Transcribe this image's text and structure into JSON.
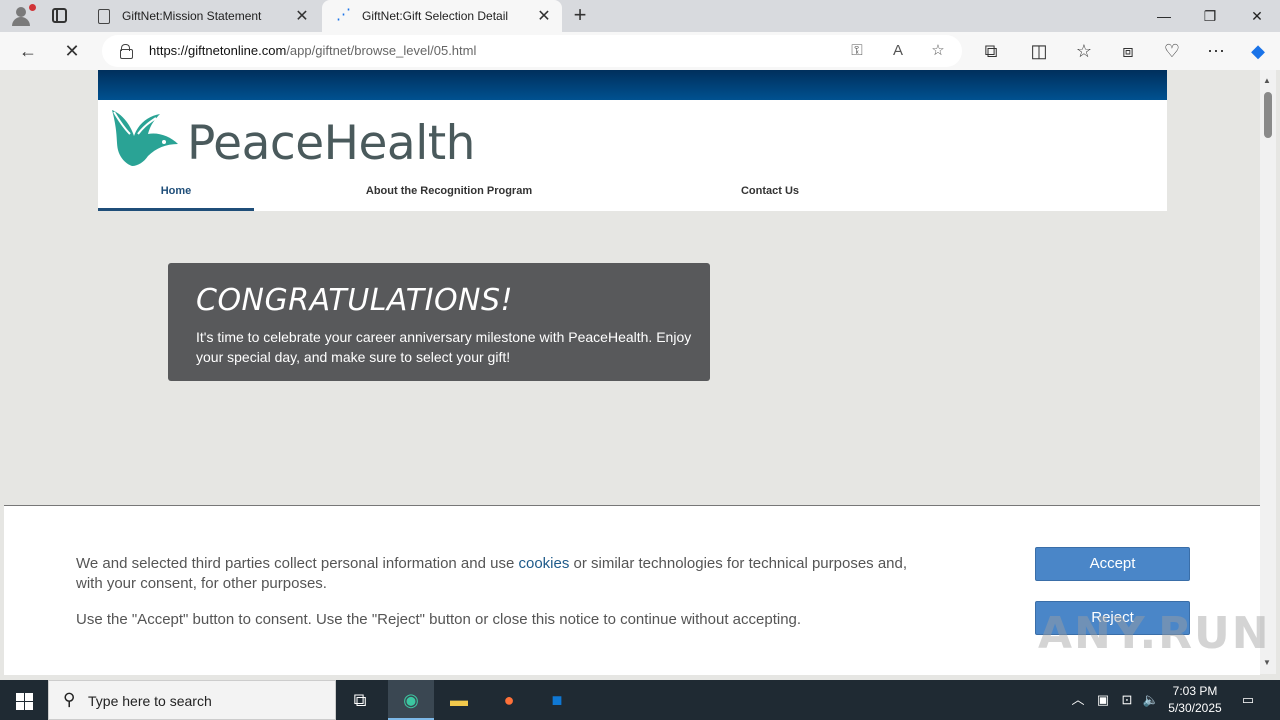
{
  "browser": {
    "tabs": [
      {
        "title": "GiftNet:Mission Statement",
        "active": false
      },
      {
        "title": "GiftNet:Gift Selection Detail",
        "active": true
      }
    ],
    "url_host": "https://giftnetonline.com",
    "url_path": "/app/giftnet/browse_level/05.html"
  },
  "site": {
    "brand": "PeaceHealth",
    "brand_color": "#2aa395",
    "nav": [
      {
        "label": "Home",
        "active": true
      },
      {
        "label": "About the Recognition Program",
        "active": false
      },
      {
        "label": "Contact Us",
        "active": false
      }
    ],
    "congrats": {
      "heading": "CONGRATULATIONS!",
      "body": "It's time to celebrate your career anniversary milestone with PeaceHealth. Enjoy your special day, and make sure to select your gift!"
    }
  },
  "cookie_banner": {
    "text1_before": "We and selected third parties collect personal information and use ",
    "text1_link": "cookies",
    "text1_after": " or similar technologies for technical purposes and, with your consent, for other purposes.",
    "text2": "Use the \"Accept\" button to consent. Use the \"Reject\" button or close this notice to continue without accepting.",
    "accept_label": "Accept",
    "reject_label": "Reject"
  },
  "watermark": "ANY.RUN",
  "taskbar": {
    "search_placeholder": "Type here to search",
    "time": "7:03 PM",
    "date": "5/30/2025"
  }
}
